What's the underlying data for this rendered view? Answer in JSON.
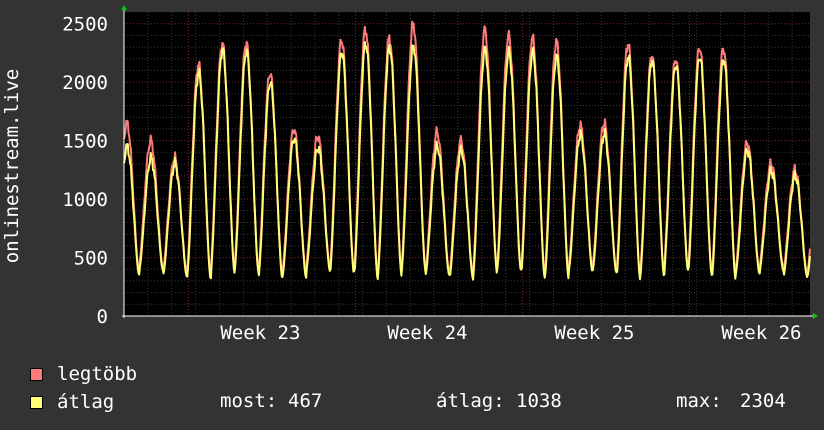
{
  "chart_data": {
    "type": "line",
    "ylabel": "onlinestream.live",
    "ylim": [
      0,
      2600
    ],
    "yticks": [
      0,
      500,
      1000,
      1500,
      2000,
      2500
    ],
    "xlabels": [
      "Week 23",
      "Week 24",
      "Week 25",
      "Week 26"
    ],
    "days": 28.75,
    "grid": true,
    "legend_placement": "bottom-left",
    "series": [
      {
        "name": "legtöbb",
        "color": "#ff7a7a",
        "daily_peaks": [
          1650,
          1500,
          1350,
          2150,
          2330,
          2340,
          2080,
          1600,
          1540,
          2360,
          2450,
          2380,
          2500,
          1570,
          1500,
          2450,
          2400,
          2380,
          2350,
          1630,
          1650,
          2330,
          2230,
          2200,
          2300,
          2290,
          1480,
          1300,
          1250
        ]
      },
      {
        "name": "átlag",
        "color": "#ffff77",
        "daily_peaks": [
          1450,
          1350,
          1300,
          2080,
          2280,
          2270,
          2000,
          1520,
          1440,
          2260,
          2330,
          2300,
          2310,
          1450,
          1420,
          2280,
          2260,
          2260,
          2220,
          1550,
          1560,
          2220,
          2190,
          2150,
          2220,
          2200,
          1420,
          1240,
          1200
        ]
      }
    ],
    "stats": {
      "most_label": "most:",
      "most_value": "467",
      "atlag_label": "átlag:",
      "atlag_value": "1038",
      "max_label": "max:",
      "max_value": "2304"
    }
  }
}
